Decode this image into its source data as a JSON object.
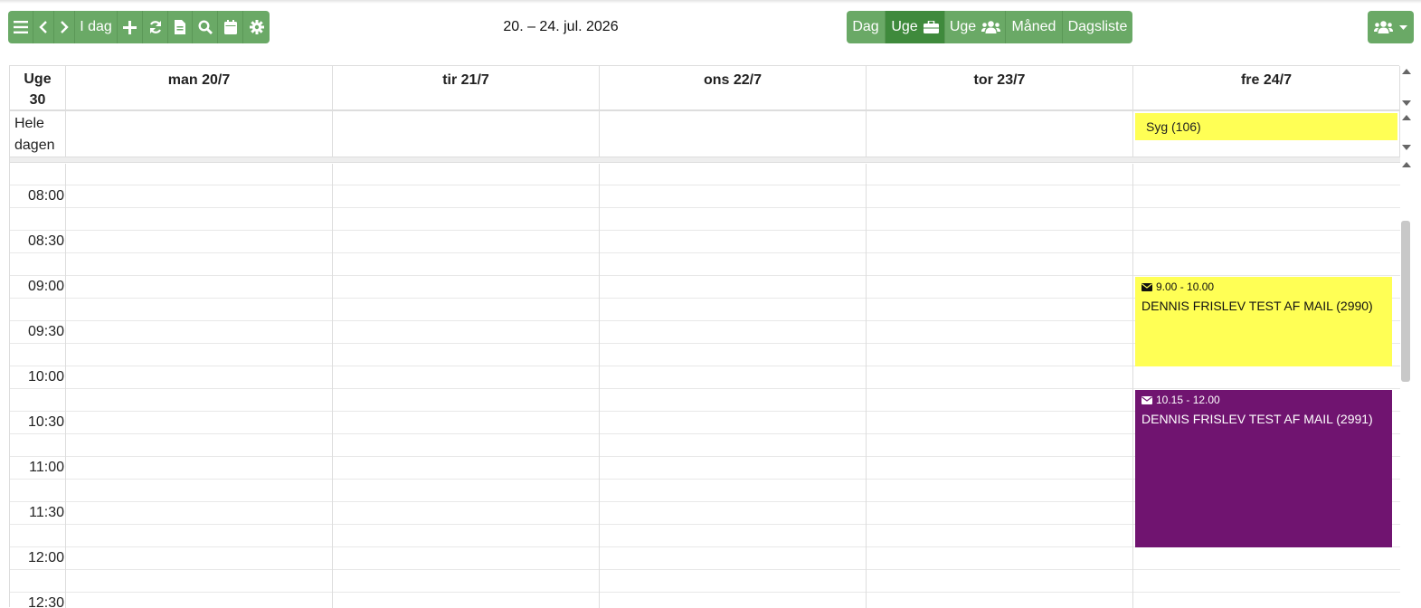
{
  "toolbar": {
    "menu_icon": "bars-icon",
    "prev_icon": "chevron-left-icon",
    "next_icon": "chevron-right-icon",
    "today_label": "I dag",
    "add_icon": "plus-icon",
    "refresh_icon": "refresh-icon",
    "document_icon": "file-icon",
    "search_icon": "search-icon",
    "calendar_icon": "calendar-icon",
    "settings_icon": "gear-icon"
  },
  "title": "20. – 24. jul. 2026",
  "views": {
    "day_label": "Dag",
    "week_label": "Uge",
    "week_group_label": "Uge",
    "month_label": "Måned",
    "daylist_label": "Dagsliste",
    "active": "week"
  },
  "calendar": {
    "week_label_line1": "Uge",
    "week_label_line2": "30",
    "allday_label_line1": "Hele",
    "allday_label_line2": "dagen",
    "days": [
      "man 20/7",
      "tir 21/7",
      "ons 22/7",
      "tor 23/7",
      "fre 24/7"
    ],
    "time_labels": [
      "08:00",
      "08:30",
      "09:00",
      "09:30",
      "10:00",
      "10:30",
      "11:00",
      "11:30",
      "12:00",
      "12:30"
    ],
    "allday_event": {
      "label": "Syg (106)",
      "color": "#ffff55"
    },
    "events": [
      {
        "time": "9.00 - 10.00",
        "title": "DENNIS FRISLEV TEST AF MAIL (2990)",
        "color": "#ffff55"
      },
      {
        "time": "10.15 - 12.00",
        "title": "DENNIS FRISLEV TEST AF MAIL (2991)",
        "color": "#701470"
      }
    ]
  },
  "colors": {
    "toolbar_green": "#6aa966",
    "active_green": "#3f8a3c"
  }
}
